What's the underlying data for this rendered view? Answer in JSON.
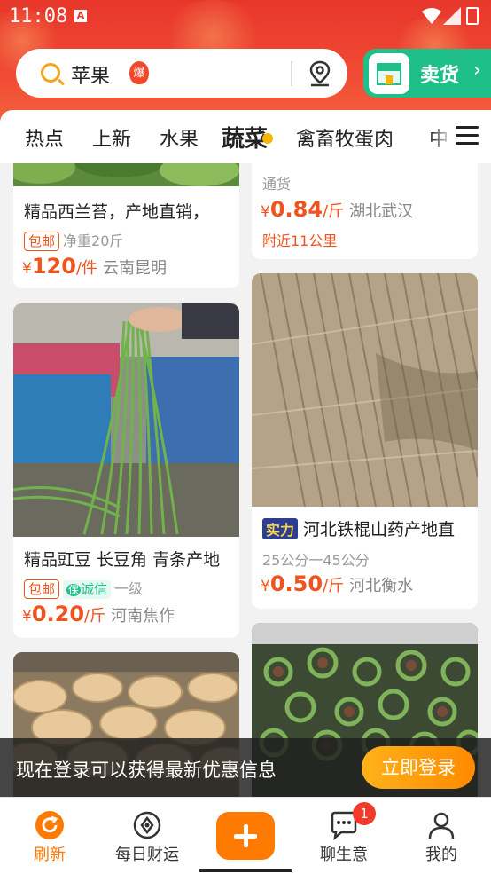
{
  "status": {
    "time": "11:08",
    "app_badge": "A"
  },
  "search": {
    "query": "苹果",
    "hot_label": "爆"
  },
  "sell_label": "卖货",
  "tabs": [
    {
      "label": "热点"
    },
    {
      "label": "上新"
    },
    {
      "label": "水果"
    },
    {
      "label": "蔬菜"
    },
    {
      "label": "禽畜牧蛋肉"
    },
    {
      "label": "中"
    }
  ],
  "products": [
    {
      "title": "精品西兰苔，产地直销，",
      "tags": {
        "shipping": "包邮",
        "detail": "净重20斤"
      },
      "price": {
        "yen": "¥",
        "value": "120",
        "unit": "/件",
        "location": "云南昆明"
      }
    },
    {
      "sub": "通货",
      "price": {
        "yen": "¥",
        "value": "0.84",
        "unit": "/斤",
        "location": "湖北武汉"
      },
      "nearby": "附近11公里"
    },
    {
      "title": "精品豇豆 长豆角 青条产地",
      "tags": {
        "shipping": "包邮",
        "guarantee_icon": "保",
        "guarantee": "诚信",
        "level": "一级"
      },
      "price": {
        "yen": "¥",
        "value": "0.20",
        "unit": "/斤",
        "location": "河南焦作"
      }
    },
    {
      "power_tag": "实力",
      "title": "河北铁棍山药产地直",
      "sub": "25公分一45公分",
      "price": {
        "yen": "¥",
        "value": "0.50",
        "unit": "/斤",
        "location": "河北衡水"
      }
    }
  ],
  "login_banner": {
    "text": "现在登录可以获得最新优惠信息",
    "button": "立即登录"
  },
  "nav": [
    {
      "label": "刷新"
    },
    {
      "label": "每日财运"
    },
    {
      "label": "聊生意",
      "badge": "1"
    },
    {
      "label": "我的"
    }
  ],
  "colors": {
    "accent": "#ff7a00",
    "price": "#f0541e",
    "header": "#e8362b",
    "sell": "#1fbf8a"
  }
}
